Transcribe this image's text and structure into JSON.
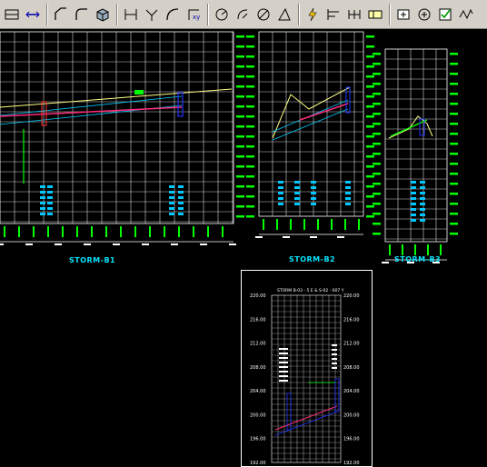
{
  "toolbar": {
    "groups": [
      [
        "dimension-linear-icon",
        "angle-icon",
        "arc-icon",
        "ordinate-icon"
      ],
      [
        "radius-icon",
        "dimension-aligned-icon",
        "diameter-icon",
        "angular-icon"
      ],
      [
        "quick-dimension-icon",
        "baseline-icon",
        "continue-icon",
        "tolerance-icon"
      ],
      [
        "center-mark-icon",
        "edit-icon",
        "check-icon",
        "wave-icon"
      ]
    ]
  },
  "profiles": [
    {
      "name": "STORM-B1"
    },
    {
      "name": "STORM-B2"
    },
    {
      "name": "STORM-B3"
    }
  ],
  "inset": {
    "header": "STORM B-03 - 5 E & S-02 - 607 Y",
    "left_elevations": [
      "220.00",
      "216.00",
      "212.00",
      "208.00",
      "204.00",
      "200.00",
      "196.00",
      "192.00"
    ],
    "right_elevations": [
      "220.00",
      "216.00",
      "212.00",
      "208.00",
      "204.00",
      "200.00",
      "196.00",
      "192.00"
    ]
  },
  "colors": {
    "background": "#000000",
    "grid": "#ffffff",
    "label_green": "#00ff00",
    "title_cyan": "#00e5ff",
    "ground": "#ffff88",
    "pipe_magenta": "#ff2a7a",
    "pipe_cyan": "#00c8ff",
    "structure_blue": "#2233ff"
  }
}
